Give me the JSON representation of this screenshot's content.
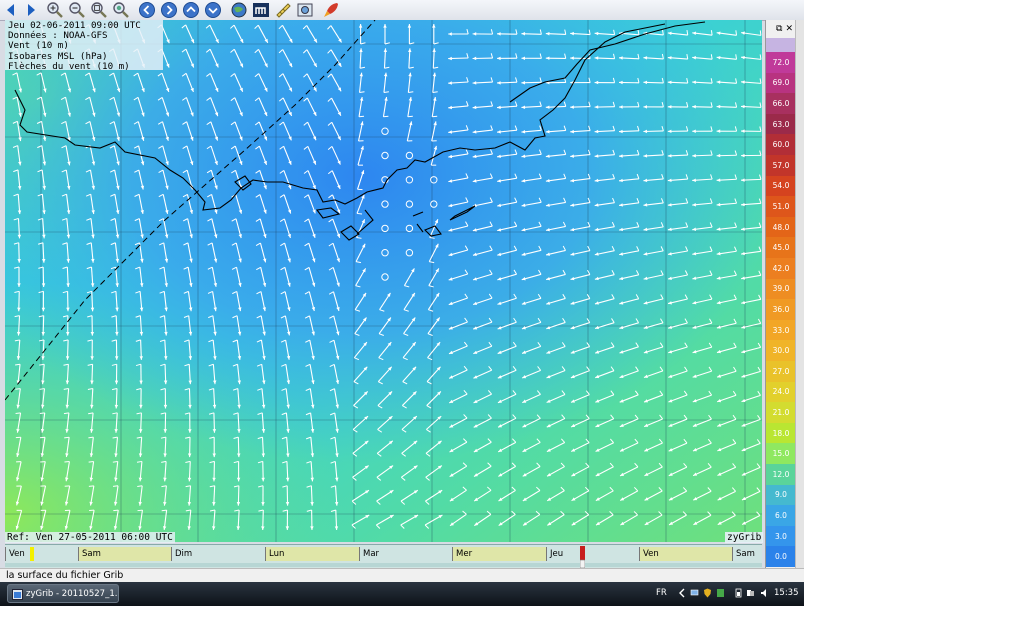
{
  "overlay": {
    "line1": "Jeu 02-06-2011 09:00 UTC",
    "line2": "Données : NOAA-GFS",
    "line3": "Vent (10 m)",
    "line4": "Isobares MSL (hPa)",
    "line5": "Flèches du vent (10 m)"
  },
  "footer": {
    "ref": "Ref: Ven 27-05-2011 06:00 UTC",
    "brand": "zyGrib"
  },
  "legend": {
    "values": [
      "72.0",
      "69.0",
      "66.0",
      "63.0",
      "60.0",
      "57.0",
      "54.0",
      "51.0",
      "48.0",
      "45.0",
      "42.0",
      "39.0",
      "36.0",
      "33.0",
      "30.0",
      "27.0",
      "24.0",
      "21.0",
      "18.0",
      "15.0",
      "12.0",
      "9.0",
      "6.0",
      "3.0",
      "0.0"
    ],
    "colors": [
      "#c03a9a",
      "#b83380",
      "#a8305f",
      "#9b2a4a",
      "#b22e37",
      "#c2352a",
      "#d5431f",
      "#de561b",
      "#e36518",
      "#e7741a",
      "#ec7f20",
      "#ee8d22",
      "#f09a24",
      "#f2a626",
      "#f0b428",
      "#e9c22a",
      "#e2d02c",
      "#d3dc30",
      "#b9e632",
      "#8fe860",
      "#5ad49a",
      "#45b9cf",
      "#3aa6e6",
      "#3495ec",
      "#2b82ea"
    ],
    "float_label": "⧉",
    "close_label": "✕"
  },
  "timeline": {
    "days": [
      "Ven",
      "Sam",
      "Dim",
      "Lun",
      "Mar",
      "Mer",
      "Jeu",
      "Ven",
      "Sam"
    ]
  },
  "statusbar": {
    "text": "la surface du fichier Grib"
  },
  "taskbar": {
    "app_button": "zyGrib - 20110527_1...",
    "lang": "FR",
    "clock": "15:35"
  },
  "toolbar": {
    "icons": [
      "arrow-left-icon",
      "arrow-right-icon",
      "zoom-in-icon",
      "zoom-out-icon",
      "zoom-fit-icon",
      "zoom-world-icon",
      "nav-left-icon",
      "nav-right-icon",
      "nav-up-icon",
      "nav-down-icon",
      "globe-icon",
      "meteotable-icon",
      "measure-icon",
      "photo-icon",
      "rocket-icon"
    ]
  },
  "colors": {
    "field_blue": "#2f8ff0",
    "field_cyan": "#35c7e8",
    "field_green": "#5fe28a",
    "arrow": "#ffffff",
    "coast": "#000000"
  }
}
